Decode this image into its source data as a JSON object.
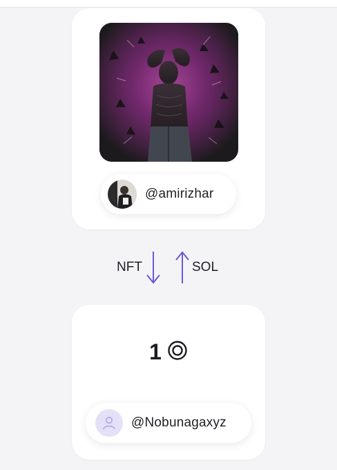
{
  "listing": {
    "nft_card": {
      "artwork_name": "nft-artwork",
      "owner_handle": "@amirizhar"
    },
    "swap": {
      "from_label": "NFT",
      "to_label": "SOL"
    },
    "payment_card": {
      "amount": "1",
      "currency_icon": "sol-coin-icon",
      "buyer_handle": "@Nobunagaxyz"
    }
  },
  "colors": {
    "background": "#f4f4f6",
    "card": "#ffffff",
    "accent_arrow": "#6a58d6",
    "avatar_placeholder_bg": "#e3e0f7",
    "avatar_placeholder_fg": "#b3abe8",
    "artwork_glow": "#8a2f86"
  }
}
